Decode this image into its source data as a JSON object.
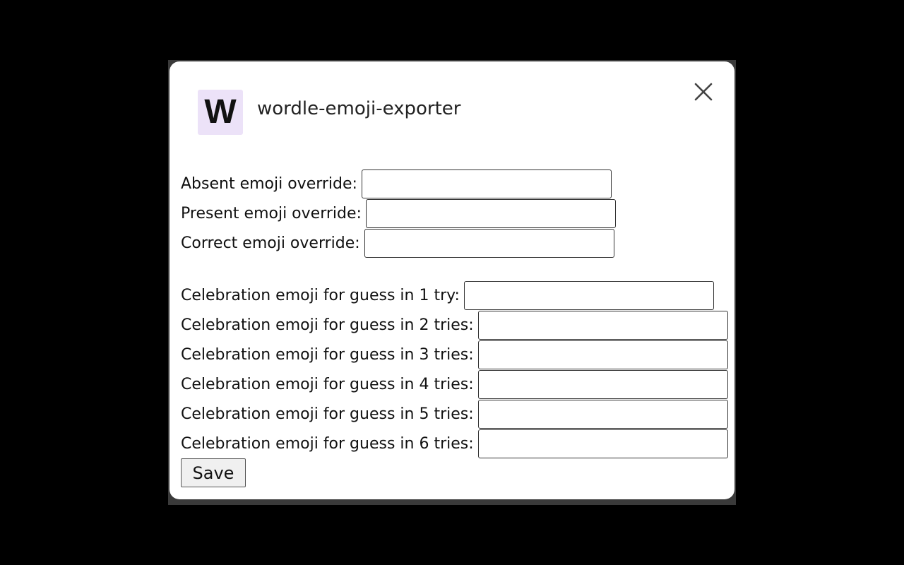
{
  "app": {
    "icon_letter": "W",
    "title": "wordle-emoji-exporter",
    "icon_bg_color": "#ece2f8"
  },
  "close_icon": "close-icon",
  "overrides": [
    {
      "label": "Absent emoji override:",
      "value": ""
    },
    {
      "label": "Present emoji override:",
      "value": ""
    },
    {
      "label": "Correct emoji override:",
      "value": ""
    }
  ],
  "celebrations": [
    {
      "label": "Celebration emoji for guess in 1 try:",
      "value": ""
    },
    {
      "label": "Celebration emoji for guess in 2 tries:",
      "value": ""
    },
    {
      "label": "Celebration emoji for guess in 3 tries:",
      "value": ""
    },
    {
      "label": "Celebration emoji for guess in 4 tries:",
      "value": ""
    },
    {
      "label": "Celebration emoji for guess in 5 tries:",
      "value": ""
    },
    {
      "label": "Celebration emoji for guess in 6 tries:",
      "value": ""
    }
  ],
  "save_label": "Save"
}
